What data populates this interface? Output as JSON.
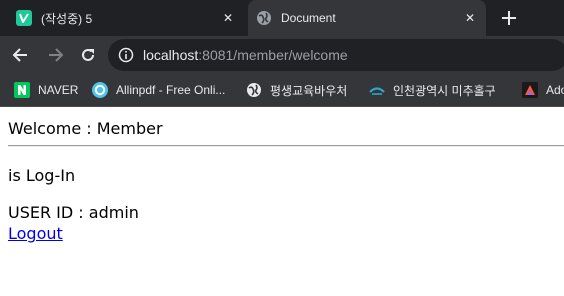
{
  "browser": {
    "tabs": [
      {
        "title": "(작성중) 5",
        "active": false,
        "favicon": "velog-icon"
      },
      {
        "title": "Document",
        "active": true,
        "favicon": "globe-icon"
      }
    ],
    "close_glyph": "✕",
    "new_tab_glyph": "+",
    "address": {
      "host": "localhost",
      "rest": ":8081/member/welcome"
    },
    "bookmarks": [
      {
        "label": "NAVER",
        "icon": "naver-icon"
      },
      {
        "label": "Allinpdf - Free Onli...",
        "icon": "allinpdf-icon"
      },
      {
        "label": "평생교육바우처",
        "icon": "globe-icon"
      },
      {
        "label": "인천광역시 미추홀구",
        "icon": "incheon-icon"
      },
      {
        "label": "Ado",
        "icon": "adobe-icon"
      }
    ]
  },
  "page": {
    "welcome": "Welcome : Member",
    "status": "is Log-In",
    "user_id": "USER ID : admin",
    "logout": "Logout"
  },
  "colors": {
    "tabstrip_bg": "#202124",
    "toolbar_bg": "#35363a",
    "link": "#0000ee",
    "velog_green": "#20c997",
    "naver_green": "#03c75a"
  }
}
